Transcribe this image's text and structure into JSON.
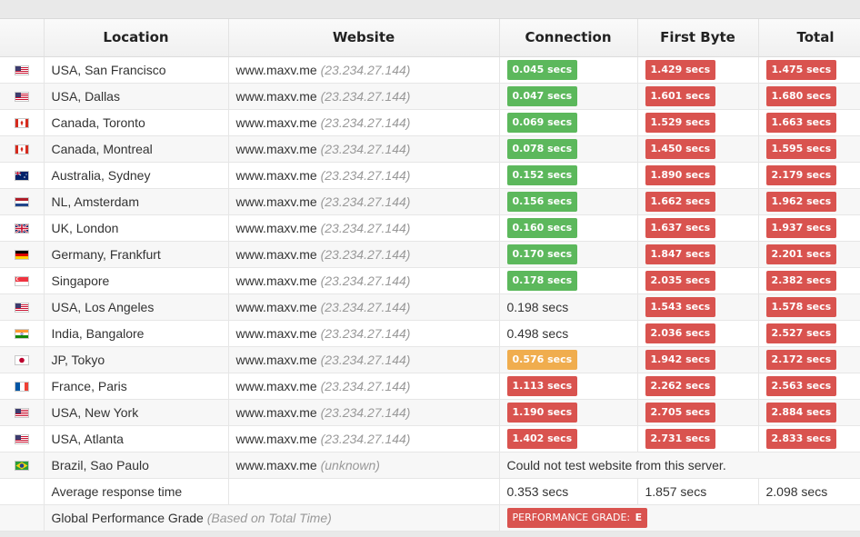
{
  "headers": {
    "location": "Location",
    "website": "Website",
    "connection": "Connection",
    "first_byte": "First Byte",
    "total": "Total"
  },
  "rows": [
    {
      "flag": "us-flag-icon",
      "location": "USA, San Francisco",
      "site": "www.maxv.me",
      "ip": "(23.234.27.144)",
      "conn": "0.045 secs",
      "conn_style": "green",
      "fb": "1.429 secs",
      "fb_style": "red",
      "total": "1.475 secs",
      "total_style": "red"
    },
    {
      "flag": "us-flag-icon",
      "location": "USA, Dallas",
      "site": "www.maxv.me",
      "ip": "(23.234.27.144)",
      "conn": "0.047 secs",
      "conn_style": "green",
      "fb": "1.601 secs",
      "fb_style": "red",
      "total": "1.680 secs",
      "total_style": "red"
    },
    {
      "flag": "ca-flag-icon",
      "location": "Canada, Toronto",
      "site": "www.maxv.me",
      "ip": "(23.234.27.144)",
      "conn": "0.069 secs",
      "conn_style": "green",
      "fb": "1.529 secs",
      "fb_style": "red",
      "total": "1.663 secs",
      "total_style": "red"
    },
    {
      "flag": "ca-flag-icon",
      "location": "Canada, Montreal",
      "site": "www.maxv.me",
      "ip": "(23.234.27.144)",
      "conn": "0.078 secs",
      "conn_style": "green",
      "fb": "1.450 secs",
      "fb_style": "red",
      "total": "1.595 secs",
      "total_style": "red"
    },
    {
      "flag": "au-flag-icon",
      "location": "Australia, Sydney",
      "site": "www.maxv.me",
      "ip": "(23.234.27.144)",
      "conn": "0.152 secs",
      "conn_style": "green",
      "fb": "1.890 secs",
      "fb_style": "red",
      "total": "2.179 secs",
      "total_style": "red"
    },
    {
      "flag": "nl-flag-icon",
      "location": "NL, Amsterdam",
      "site": "www.maxv.me",
      "ip": "(23.234.27.144)",
      "conn": "0.156 secs",
      "conn_style": "green",
      "fb": "1.662 secs",
      "fb_style": "red",
      "total": "1.962 secs",
      "total_style": "red"
    },
    {
      "flag": "uk-flag-icon",
      "location": "UK, London",
      "site": "www.maxv.me",
      "ip": "(23.234.27.144)",
      "conn": "0.160 secs",
      "conn_style": "green",
      "fb": "1.637 secs",
      "fb_style": "red",
      "total": "1.937 secs",
      "total_style": "red"
    },
    {
      "flag": "de-flag-icon",
      "location": "Germany, Frankfurt",
      "site": "www.maxv.me",
      "ip": "(23.234.27.144)",
      "conn": "0.170 secs",
      "conn_style": "green",
      "fb": "1.847 secs",
      "fb_style": "red",
      "total": "2.201 secs",
      "total_style": "red"
    },
    {
      "flag": "sg-flag-icon",
      "location": "Singapore",
      "site": "www.maxv.me",
      "ip": "(23.234.27.144)",
      "conn": "0.178 secs",
      "conn_style": "green",
      "fb": "2.035 secs",
      "fb_style": "red",
      "total": "2.382 secs",
      "total_style": "red"
    },
    {
      "flag": "us-flag-icon",
      "location": "USA, Los Angeles",
      "site": "www.maxv.me",
      "ip": "(23.234.27.144)",
      "conn": "0.198 secs",
      "conn_style": "plain",
      "fb": "1.543 secs",
      "fb_style": "red",
      "total": "1.578 secs",
      "total_style": "red"
    },
    {
      "flag": "in-flag-icon",
      "location": "India, Bangalore",
      "site": "www.maxv.me",
      "ip": "(23.234.27.144)",
      "conn": "0.498 secs",
      "conn_style": "plain",
      "fb": "2.036 secs",
      "fb_style": "red",
      "total": "2.527 secs",
      "total_style": "red"
    },
    {
      "flag": "jp-flag-icon",
      "location": "JP, Tokyo",
      "site": "www.maxv.me",
      "ip": "(23.234.27.144)",
      "conn": "0.576 secs",
      "conn_style": "orange",
      "fb": "1.942 secs",
      "fb_style": "red",
      "total": "2.172 secs",
      "total_style": "red"
    },
    {
      "flag": "fr-flag-icon",
      "location": "France, Paris",
      "site": "www.maxv.me",
      "ip": "(23.234.27.144)",
      "conn": "1.113 secs",
      "conn_style": "red",
      "fb": "2.262 secs",
      "fb_style": "red",
      "total": "2.563 secs",
      "total_style": "red"
    },
    {
      "flag": "us-flag-icon",
      "location": "USA, New York",
      "site": "www.maxv.me",
      "ip": "(23.234.27.144)",
      "conn": "1.190 secs",
      "conn_style": "red",
      "fb": "2.705 secs",
      "fb_style": "red",
      "total": "2.884 secs",
      "total_style": "red"
    },
    {
      "flag": "us-flag-icon",
      "location": "USA, Atlanta",
      "site": "www.maxv.me",
      "ip": "(23.234.27.144)",
      "conn": "1.402 secs",
      "conn_style": "red",
      "fb": "2.731 secs",
      "fb_style": "red",
      "total": "2.833 secs",
      "total_style": "red"
    }
  ],
  "failed_row": {
    "flag": "br-flag-icon",
    "location": "Brazil, Sao Paulo",
    "site": "www.maxv.me",
    "ip": "(unknown)",
    "message": "Could not test website from this server."
  },
  "average": {
    "label": "Average response time",
    "conn": "0.353 secs",
    "fb": "1.857 secs",
    "total": "2.098 secs"
  },
  "grade": {
    "label": "Global Performance Grade",
    "note": "(Based on Total Time)",
    "badge_label": "PERFORMANCE GRADE:",
    "badge_value": "E"
  },
  "colors": {
    "green": "#5cb85c",
    "red": "#d9534f",
    "orange": "#f0ad4e"
  }
}
